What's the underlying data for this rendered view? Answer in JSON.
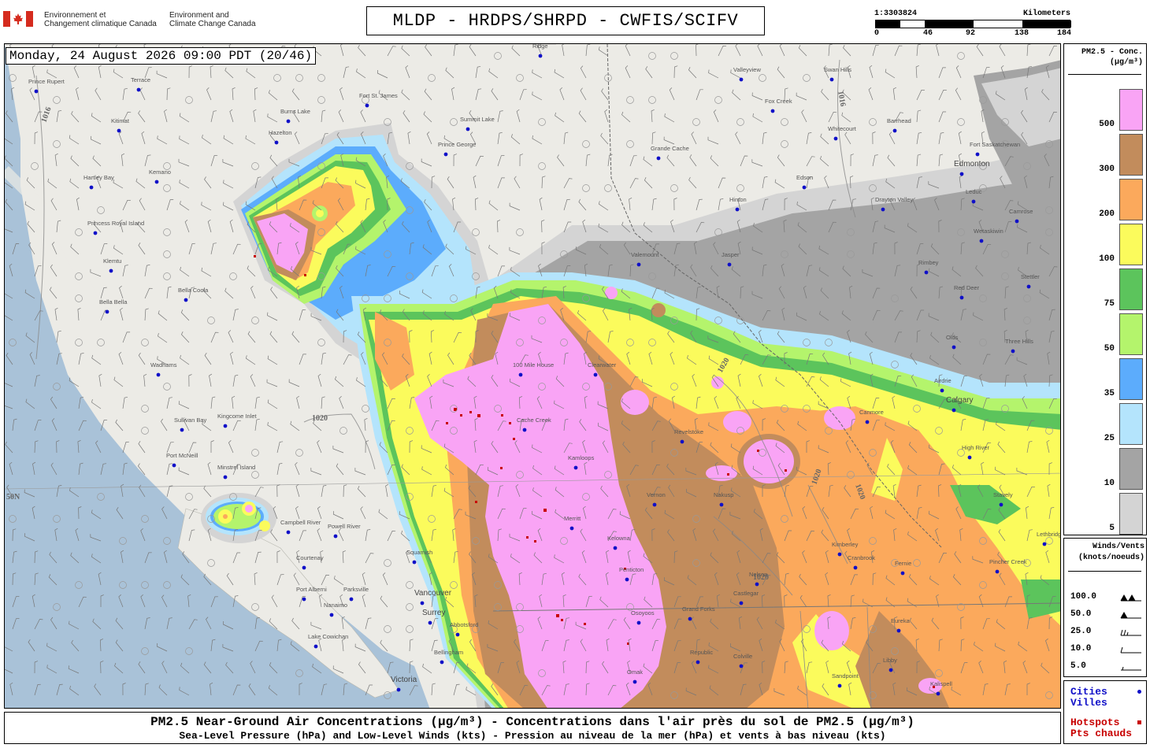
{
  "header": {
    "dept_fr_line1": "Environnement et",
    "dept_fr_line2": "Changement climatique Canada",
    "dept_en_line1": "Environment and",
    "dept_en_line2": "Climate Change Canada",
    "title": "MLDP - HRDPS/SHRPD - CWFIS/SCIFV"
  },
  "scale": {
    "ratio": "1:3303824",
    "unit": "Kilometers",
    "ticks": [
      "0",
      "46",
      "92",
      "138",
      "184"
    ]
  },
  "timestamp": "Monday, 24 August 2026 09:00 PDT (20/46)",
  "legend": {
    "title_line1": "PM2.5 - Conc.",
    "title_line2": "(µg/m³)",
    "bins": [
      {
        "label": "500",
        "color": "#f9a4f5"
      },
      {
        "label": "300",
        "color": "#c28c5c"
      },
      {
        "label": "200",
        "color": "#fba95c"
      },
      {
        "label": "100",
        "color": "#fbfb5c"
      },
      {
        "label": "75",
        "color": "#5cc45c"
      },
      {
        "label": "50",
        "color": "#b4f46c"
      },
      {
        "label": "35",
        "color": "#5cacfc"
      },
      {
        "label": "25",
        "color": "#b4e4fc"
      },
      {
        "label": "10",
        "color": "#a4a4a4"
      },
      {
        "label": "5",
        "color": "#d4d4d4"
      }
    ]
  },
  "winds": {
    "title_line1": "Winds/Vents",
    "title_line2": "(knots/noeuds)",
    "values": [
      "100.0",
      "50.0",
      "25.0",
      "10.0",
      "5.0"
    ]
  },
  "key": {
    "cities_en": "Cities",
    "cities_fr": "Villes",
    "hotspots_en": "Hotspots",
    "hotspots_fr": "Pts chauds",
    "city_color": "#1010c8",
    "hotspot_color": "#c80000"
  },
  "caption": {
    "line1": "PM2.5 Near-Ground Air Concentrations (µg/m³) - Concentrations dans l'air près du sol de PM2.5 (µg/m³)",
    "line2": "Sea-Level Pressure (hPa) and Low-Level Winds (kts) - Pression au niveau de la mer (hPa) et vents à bas niveau (kts)"
  },
  "map": {
    "isobar_labels": [
      "1016",
      "1016",
      "1020",
      "1020",
      "1020",
      "1020",
      "1020"
    ],
    "lat_label": "50N",
    "places": [
      "Prince Rupert",
      "Terrace",
      "Hazelton",
      "Burns Lake",
      "Fort St. James",
      "Prince George",
      "Summit Lake",
      "Kitimat",
      "Kemano",
      "Hartley Bay",
      "Princess Royal Island",
      "Klemtu",
      "Bella Bella",
      "Bella Coola",
      "Wadhams",
      "Sullivan Bay",
      "Port McNeill",
      "Kingcome Inlet",
      "Minstrel Island",
      "Campbell River",
      "Powell River",
      "Courtenay",
      "Port Alberni",
      "Parksville",
      "Nanaimo",
      "Lake Cowichan",
      "Victoria",
      "Vancouver",
      "Surrey",
      "Abbotsford",
      "Bellingham",
      "Squamish",
      "100 Mile House",
      "Clearwater",
      "Cache Creek",
      "Kamloops",
      "Merritt",
      "Kelowna",
      "Penticton",
      "Osoyoos",
      "Vernon",
      "Revelstoke",
      "Nakusp",
      "Nelson",
      "Castlegar",
      "Grand Forks",
      "Republic",
      "Colville",
      "Omak",
      "Cranbrook",
      "Kimberley",
      "Fernie",
      "Eureka",
      "Libby",
      "Sandpoint",
      "Kalispell",
      "Canmore",
      "Calgary",
      "High River",
      "Airdrie",
      "Olds",
      "Red Deer",
      "Three Hills",
      "Stettler",
      "Rimbey",
      "Camrose",
      "Wetaskiwin",
      "Leduc",
      "Edmonton",
      "Fort Saskatchewan",
      "Barrhead",
      "Whitecourt",
      "Fox Creek",
      "Swan Hills",
      "Valleyview",
      "Grande Cache",
      "Hinton",
      "Edson",
      "Drayton Valley",
      "Jasper",
      "Valemount",
      "Lethbridge",
      "Stavely",
      "Pincher Creek",
      "Ridge"
    ]
  }
}
